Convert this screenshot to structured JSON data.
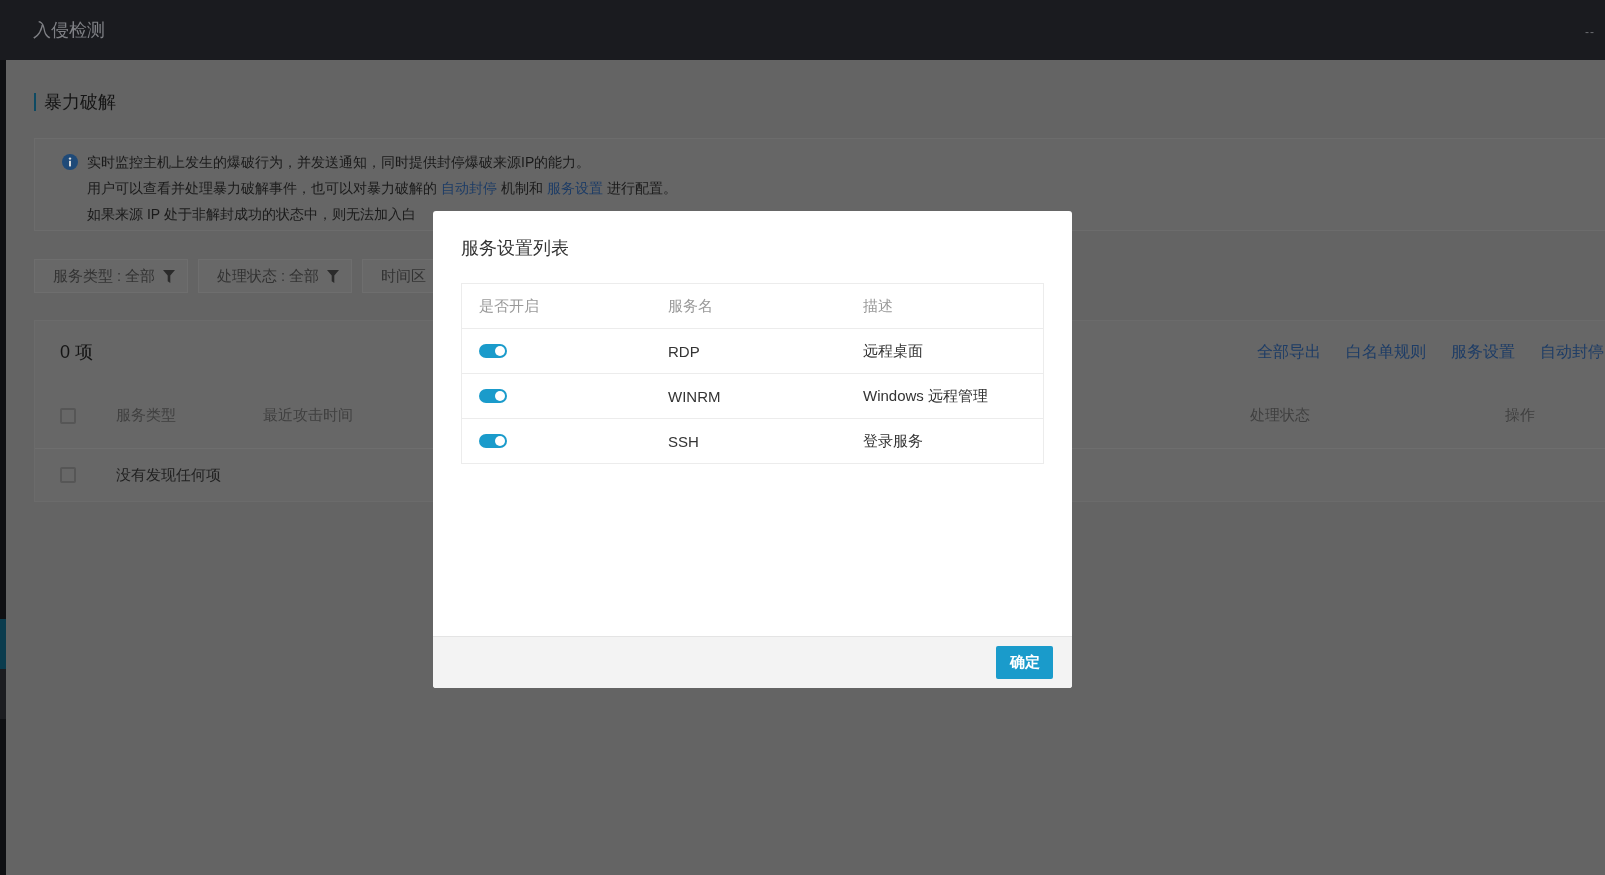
{
  "header": {
    "title": "入侵检测",
    "status_text": "--"
  },
  "sidebar": {
    "items": [
      {
        "selected": true
      },
      {
        "selected": false
      }
    ]
  },
  "section": {
    "title": "暴力破解"
  },
  "info": {
    "lines": [
      [
        {
          "kind": "text",
          "text": "实时监控主机上发生的爆破行为，并发送通知，同时提供封停爆破来源IP的能力。"
        }
      ],
      [
        {
          "kind": "text",
          "text": "用户可以查看并处理暴力破解事件，也可以对暴力破解的 "
        },
        {
          "kind": "link",
          "text": "自动封停"
        },
        {
          "kind": "text",
          "text": " 机制和 "
        },
        {
          "kind": "link",
          "text": "服务设置"
        },
        {
          "kind": "text",
          "text": " 进行配置。"
        }
      ],
      [
        {
          "kind": "text",
          "text": "如果来源 IP 处于非解封成功的状态中，则无法加入白"
        }
      ]
    ]
  },
  "filters": [
    {
      "kind": "select",
      "label": "服务类型 : 全部"
    },
    {
      "kind": "select",
      "label": "处理状态 : 全部"
    },
    {
      "kind": "range",
      "label": "时间区"
    }
  ],
  "table": {
    "count": "0 项",
    "actions": [
      "全部导出",
      "白名单规则",
      "服务设置",
      "自动封停"
    ],
    "select_all": {
      "checked": false
    },
    "columns": [
      "服务类型",
      "最近攻击时间",
      "处理状态",
      "操作"
    ],
    "empty_row": {
      "checked": false,
      "message": "没有发现任何项"
    }
  },
  "modal": {
    "title": "服务设置列表",
    "columns": [
      "是否开启",
      "服务名",
      "描述"
    ],
    "rows": [
      {
        "enabled": true,
        "name": "RDP",
        "description": "远程桌面"
      },
      {
        "enabled": true,
        "name": "WINRM",
        "description": "Windows 远程管理"
      },
      {
        "enabled": true,
        "name": "SSH",
        "description": "登录服务"
      }
    ],
    "confirm_label": "确定"
  }
}
